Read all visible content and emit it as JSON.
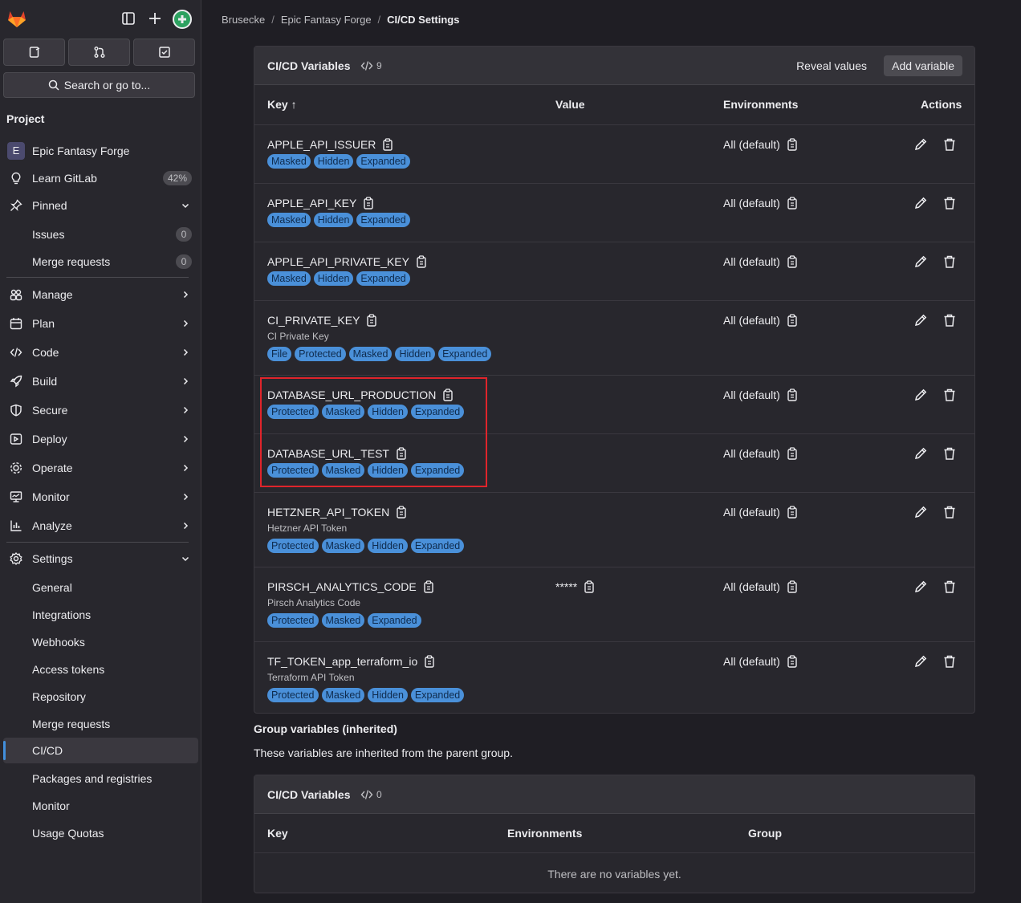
{
  "sidebar": {
    "search_label": "Search or go to...",
    "section_title": "Project",
    "project_name": "Epic Fantasy Forge",
    "project_initial": "E",
    "learn_gitlab": "Learn GitLab",
    "learn_progress": "42%",
    "pinned": "Pinned",
    "pinned_items": [
      {
        "label": "Issues",
        "count": "0"
      },
      {
        "label": "Merge requests",
        "count": "0"
      }
    ],
    "groups": [
      "Manage",
      "Plan",
      "Code",
      "Build",
      "Secure",
      "Deploy",
      "Operate",
      "Monitor",
      "Analyze"
    ],
    "settings": "Settings",
    "settings_items": [
      "General",
      "Integrations",
      "Webhooks",
      "Access tokens",
      "Repository",
      "Merge requests",
      "CI/CD",
      "Packages and registries",
      "Monitor",
      "Usage Quotas"
    ],
    "active_item": "CI/CD"
  },
  "breadcrumb": [
    "Brusecke",
    "Epic Fantasy Forge",
    "CI/CD Settings"
  ],
  "variables_card": {
    "title": "CI/CD Variables",
    "count": "9",
    "reveal_label": "Reveal values",
    "add_label": "Add variable",
    "columns": {
      "key": "Key",
      "value": "Value",
      "environments": "Environments",
      "actions": "Actions"
    },
    "sort_indicator": "↑",
    "rows": [
      {
        "key": "APPLE_API_ISSUER",
        "desc": "",
        "value": "",
        "badges": [
          "Masked",
          "Hidden",
          "Expanded"
        ],
        "env": "All (default)"
      },
      {
        "key": "APPLE_API_KEY",
        "desc": "",
        "value": "",
        "badges": [
          "Masked",
          "Hidden",
          "Expanded"
        ],
        "env": "All (default)"
      },
      {
        "key": "APPLE_API_PRIVATE_KEY",
        "desc": "",
        "value": "",
        "badges": [
          "Masked",
          "Hidden",
          "Expanded"
        ],
        "env": "All (default)"
      },
      {
        "key": "CI_PRIVATE_KEY",
        "desc": "CI Private Key",
        "value": "",
        "badges": [
          "File",
          "Protected",
          "Masked",
          "Hidden",
          "Expanded"
        ],
        "env": "All (default)"
      },
      {
        "key": "DATABASE_URL_PRODUCTION",
        "desc": "",
        "value": "",
        "badges": [
          "Protected",
          "Masked",
          "Hidden",
          "Expanded"
        ],
        "env": "All (default)"
      },
      {
        "key": "DATABASE_URL_TEST",
        "desc": "",
        "value": "",
        "badges": [
          "Protected",
          "Masked",
          "Hidden",
          "Expanded"
        ],
        "env": "All (default)"
      },
      {
        "key": "HETZNER_API_TOKEN",
        "desc": "Hetzner API Token",
        "value": "",
        "badges": [
          "Protected",
          "Masked",
          "Hidden",
          "Expanded"
        ],
        "env": "All (default)"
      },
      {
        "key": "PIRSCH_ANALYTICS_CODE",
        "desc": "Pirsch Analytics Code",
        "value": "*****",
        "badges": [
          "Protected",
          "Masked",
          "Expanded"
        ],
        "env": "All (default)"
      },
      {
        "key": "TF_TOKEN_app_terraform_io",
        "desc": "Terraform API Token",
        "value": "",
        "badges": [
          "Protected",
          "Masked",
          "Hidden",
          "Expanded"
        ],
        "env": "All (default)"
      }
    ]
  },
  "group_section": {
    "heading": "Group variables (inherited)",
    "description": "These variables are inherited from the parent group.",
    "card_title": "CI/CD Variables",
    "count": "0",
    "columns": {
      "key": "Key",
      "environments": "Environments",
      "group": "Group"
    },
    "empty": "There are no variables yet."
  }
}
